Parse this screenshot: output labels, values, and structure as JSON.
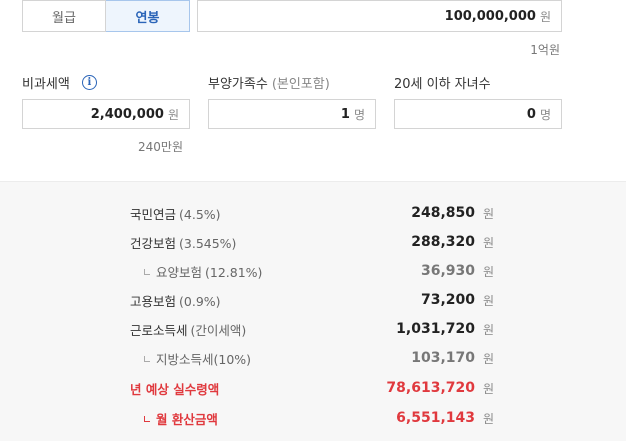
{
  "tabs": [
    {
      "label": "월급",
      "active": false
    },
    {
      "label": "연봉",
      "active": true
    }
  ],
  "salary": {
    "value": "100,000,000",
    "unit": "원",
    "hint": "1억원"
  },
  "fields": {
    "nontax": {
      "label": "비과세액",
      "value": "2,400,000",
      "unit": "원",
      "hint": "240만원"
    },
    "dependents": {
      "label": "부양가족수",
      "sublabel": "(본인포함)",
      "value": "1",
      "unit": "명"
    },
    "children": {
      "label": "20세 이하 자녀수",
      "value": "0",
      "unit": "명"
    }
  },
  "results": [
    {
      "label": "국민연금",
      "pct": "(4.5%)",
      "amount": "248,850",
      "unit": "원"
    },
    {
      "label": "건강보험",
      "pct": "(3.545%)",
      "amount": "288,320",
      "unit": "원"
    },
    {
      "label": "요양보험",
      "pct": "(12.81%)",
      "amount": "36,930",
      "unit": "원"
    },
    {
      "label": "고용보험",
      "pct": "(0.9%)",
      "amount": "73,200",
      "unit": "원"
    },
    {
      "label": "근로소득세",
      "pct": "(간이세액)",
      "amount": "1,031,720",
      "unit": "원"
    },
    {
      "label": "지방소득세(10%)",
      "pct": "",
      "amount": "103,170",
      "unit": "원"
    },
    {
      "label": "년 예상 실수령액",
      "pct": "",
      "amount": "78,613,720",
      "unit": "원"
    },
    {
      "label": "월 환산금액",
      "pct": "",
      "amount": "6,551,143",
      "unit": "원"
    }
  ],
  "colors": {
    "accent": "#2a64b8",
    "highlight": "#e0393e",
    "result_bg": "#f7f7f7"
  }
}
